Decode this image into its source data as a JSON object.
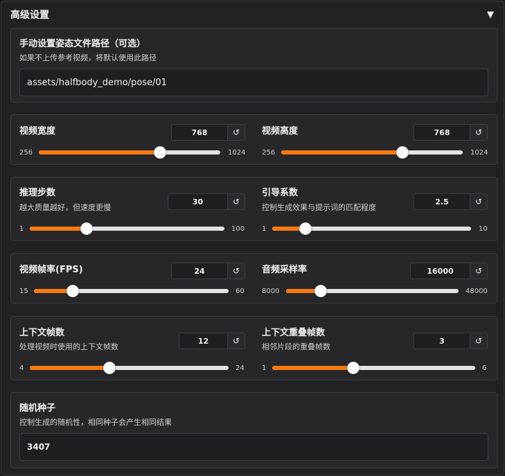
{
  "accordion": {
    "title": "高级设置",
    "toggle_icon": "▼"
  },
  "pose_path": {
    "label": "手动设置姿态文件路径（可选）",
    "info": "如果不上传参考视频，将默认使用此路径",
    "value": "assets/halfbody_demo/pose/01"
  },
  "reset_icon": "↺",
  "sliders": [
    {
      "id": "width",
      "label": "视频宽度",
      "info": "",
      "value": "768",
      "min": "256",
      "max": "1024",
      "num": 768,
      "lo": 256,
      "hi": 1024
    },
    {
      "id": "height",
      "label": "视频高度",
      "info": "",
      "value": "768",
      "min": "256",
      "max": "1024",
      "num": 768,
      "lo": 256,
      "hi": 1024
    },
    {
      "id": "steps",
      "label": "推理步数",
      "info": "越大质量越好，但速度更慢",
      "value": "30",
      "min": "1",
      "max": "100",
      "num": 30,
      "lo": 1,
      "hi": 100
    },
    {
      "id": "cfg",
      "label": "引导系数",
      "info": "控制生成效果与提示词的匹配程度",
      "value": "2.5",
      "min": "1",
      "max": "10",
      "num": 2.5,
      "lo": 1,
      "hi": 10
    },
    {
      "id": "fps",
      "label": "视频帧率(FPS)",
      "info": "",
      "value": "24",
      "min": "15",
      "max": "60",
      "num": 24,
      "lo": 15,
      "hi": 60
    },
    {
      "id": "sample_rate",
      "label": "音频采样率",
      "info": "",
      "value": "16000",
      "min": "8000",
      "max": "48000",
      "num": 16000,
      "lo": 8000,
      "hi": 48000
    },
    {
      "id": "context_frames",
      "label": "上下文帧数",
      "info": "处理视频时使用的上下文帧数",
      "value": "12",
      "min": "4",
      "max": "24",
      "num": 12,
      "lo": 4,
      "hi": 24
    },
    {
      "id": "overlap_frames",
      "label": "上下文重叠帧数",
      "info": "相邻片段的重叠帧数",
      "value": "3",
      "min": "1",
      "max": "6",
      "num": 3,
      "lo": 1,
      "hi": 6
    }
  ],
  "seed": {
    "label": "随机种子",
    "info": "控制生成的随机性，相同种子会产生相同结果",
    "value": "3407"
  },
  "colors": {
    "accent": "#f57a13",
    "track": "#e4e4e4",
    "panel": "#212123",
    "card": "#27272a"
  }
}
